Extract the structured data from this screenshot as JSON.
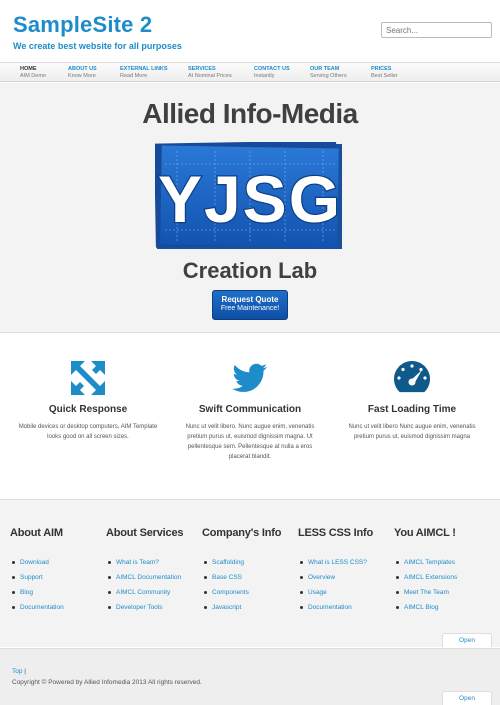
{
  "site": {
    "title": "SampleSite 2",
    "tagline": "We create best website for all purposes",
    "search_placeholder": "Search..."
  },
  "nav": [
    {
      "label": "HOME",
      "sub": "AIM Demo",
      "active": true
    },
    {
      "label": "ABOUT US",
      "sub": "Know More"
    },
    {
      "label": "EXTERNAL LINKS",
      "sub": "Read More"
    },
    {
      "label": "SERVICES",
      "sub": "At Nominal Prices"
    },
    {
      "label": "CONTACT US",
      "sub": "Instantly"
    },
    {
      "label": "OUR TEAM",
      "sub": "Serving Others"
    },
    {
      "label": "PRICES",
      "sub": "Best Seller"
    }
  ],
  "hero": {
    "title": "Allied Info-Media",
    "logo_text": "YJSG",
    "subtitle": "Creation Lab",
    "button_main": "Request Quote",
    "button_sub": "Free Maintenance!"
  },
  "features": [
    {
      "icon": "expand-arrows-icon",
      "title": "Quick Response",
      "text": "Mobile devices or desktop computers, AIM Template looks good on all screen sizes."
    },
    {
      "icon": "twitter-bird-icon",
      "title": "Swift Communication",
      "text": "Nunc ut velit libero. Nunc augue enim, venenatis pretium purus ut, euismod dignissim magna. Ut pellentesque sem. Pellentesque at nulla a eros placerat blandit."
    },
    {
      "icon": "speedometer-icon",
      "title": "Fast Loading Time",
      "text": "Nunc ut velit libero Nunc augue enim, venenatis pretium purus ut, euismod dignissim magna"
    }
  ],
  "footer_columns": [
    {
      "title": "About AIM",
      "links": [
        "Download",
        "Support",
        "Blog",
        "Documentation"
      ]
    },
    {
      "title": "About Services",
      "links": [
        "What is Team?",
        "AIMCL Documentation",
        "AIMCL Community",
        "Developer Tools"
      ]
    },
    {
      "title": "Company's Info",
      "links": [
        "Scaffolding",
        "Base CSS",
        "Components",
        "Javascript"
      ]
    },
    {
      "title": "LESS CSS Info",
      "links": [
        "What is LESS CSS?",
        "Overview",
        "Usage",
        "Documentation"
      ]
    },
    {
      "title": "You AIMCL !",
      "links": [
        "AIMCL Templates",
        "AIMCL Extensions",
        "Meet The Team",
        "AIMCL Blog"
      ]
    }
  ],
  "open_label": "Open",
  "bottom": {
    "top_link": "Top",
    "separator": "|",
    "copyright": "Copyright © Powered by Allied Infomedia 2013 All rights reserved."
  },
  "colors": {
    "brand": "#1e8cc8",
    "logo_blue": "#1a5fc4",
    "button_blue": "#0e4fa5"
  }
}
